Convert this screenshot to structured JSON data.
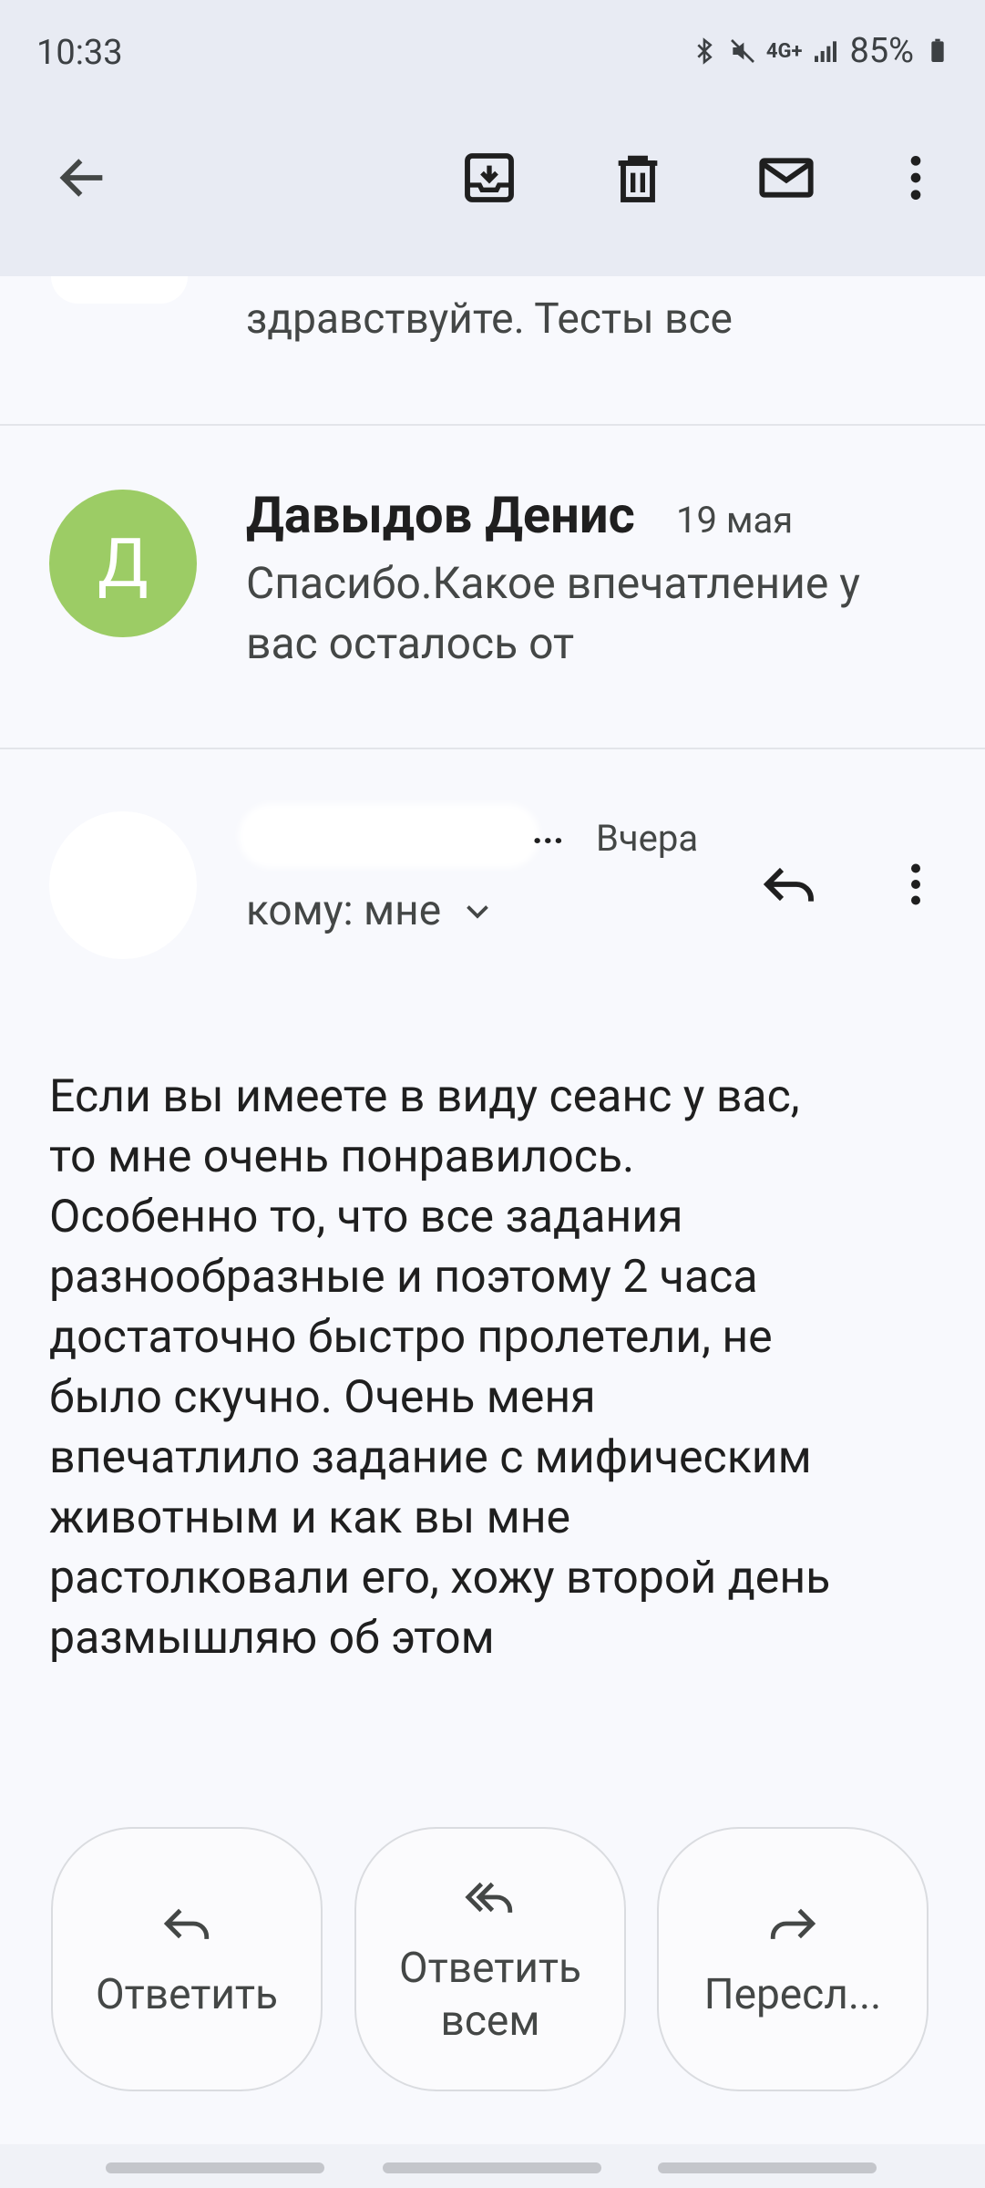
{
  "status_bar": {
    "time": "10:33",
    "network": "4G+",
    "battery": "85%"
  },
  "toolbar": {
    "back_icon": "arrow-left-icon",
    "archive_icon": "archive-icon",
    "delete_icon": "trash-icon",
    "mark_unread_icon": "mail-icon",
    "more_icon": "more-vert-icon"
  },
  "previous_message": {
    "snippet": "здравствуйте. Тесты все"
  },
  "message_collapsed": {
    "avatar_letter": "Д",
    "avatar_color": "#9ccc65",
    "sender": "Давыдов Денис",
    "date": "19 мая",
    "snippet": "Спасибо.Какое впечатление у вас осталось от"
  },
  "message_expanded": {
    "sender_ellipsis": "...",
    "date": "Вчера",
    "to_line": "кому: мне",
    "body": "Если вы имеете в виду сеанс у вас,\nто мне очень понравилось.\nОсобенно то, что все задания\nразнообразные и поэтому 2 часа\nдостаточно быстро пролетели, не\nбыло скучно. Очень меня\nвпечатлило задание с мифическим\nживотным и как вы мне\nрастолковали его, хожу второй день\nразмышляю об этом"
  },
  "actions": {
    "reply": "Ответить",
    "reply_all": "Ответить всем",
    "forward": "Пересл..."
  }
}
